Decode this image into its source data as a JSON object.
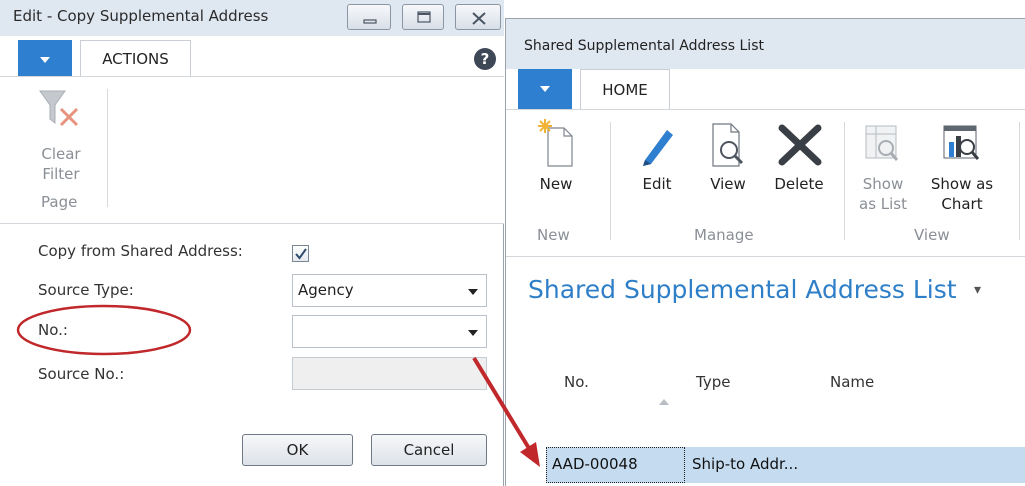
{
  "dialog": {
    "title": "Edit - Copy Supplemental Address",
    "tab_label": "ACTIONS",
    "help_glyph": "?",
    "ribbon": {
      "clear_filter_line1": "Clear",
      "clear_filter_line2": "Filter",
      "group_page": "Page"
    },
    "form": {
      "copy_from_label": "Copy from Shared Address:",
      "copy_from_checked": true,
      "source_type_label": "Source Type:",
      "source_type_value": "Agency",
      "no_label": "No.:",
      "no_value": "",
      "source_no_label": "Source No.:",
      "source_no_value": ""
    },
    "ok_label": "OK",
    "cancel_label": "Cancel"
  },
  "list_window": {
    "title": "Shared Supplemental Address List",
    "tab_label": "HOME",
    "ribbon": {
      "new_label": "New",
      "group_new": "New",
      "edit_label": "Edit",
      "view_label": "View",
      "delete_label": "Delete",
      "group_manage": "Manage",
      "show_as_list_line1": "Show",
      "show_as_list_line2": "as List",
      "show_as_chart_line1": "Show as",
      "show_as_chart_line2": "Chart",
      "group_view": "View"
    },
    "page_title": "Shared Supplemental Address List",
    "page_title_caret": "▾",
    "columns": [
      "No.",
      "Type",
      "Name"
    ],
    "rows": [
      {
        "no": "AAD-00048",
        "type": "Ship-to Addr...",
        "name": ""
      }
    ]
  },
  "colors": {
    "accent": "#2f7fd0",
    "link_title": "#2f7fc8",
    "selected_row": "#c5dcf0",
    "annotation": "#c0282b"
  }
}
